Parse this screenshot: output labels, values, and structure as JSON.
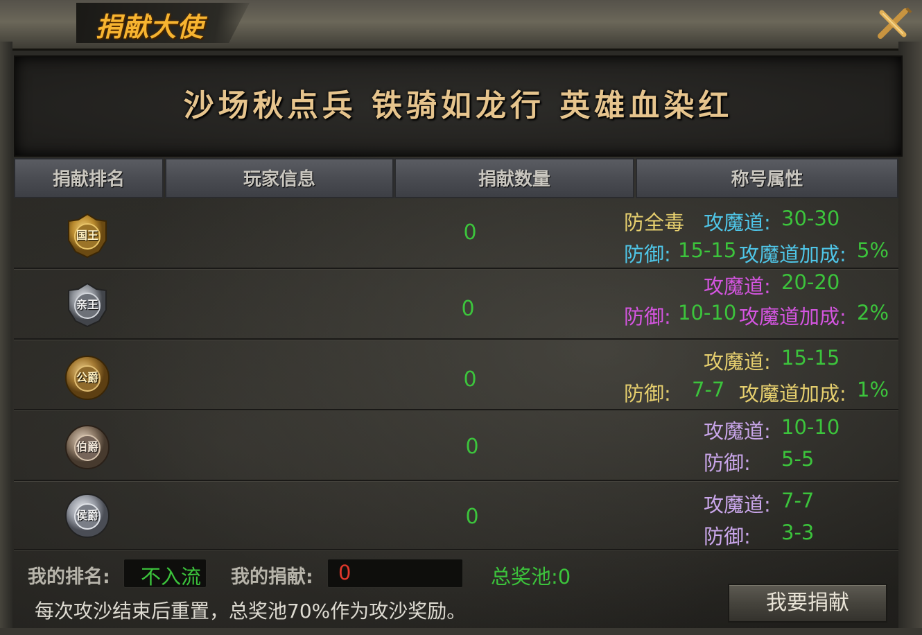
{
  "window": {
    "title": "捐献大使"
  },
  "banner": {
    "slogan": "沙场秋点兵 铁骑如龙行 英雄血染红"
  },
  "table": {
    "headers": [
      "捐献排名",
      "玩家信息",
      "捐献数量",
      "称号属性"
    ],
    "rows": [
      {
        "rank_title": "国王",
        "player": "",
        "amount": "0",
        "attributes": {
          "poison_resist": "防全毒",
          "magic_label": "攻魔道:",
          "magic_value": "30-30",
          "defense_label": "防御:",
          "defense_value": "15-15",
          "bonus_label": "攻魔道加成:",
          "bonus_value": "5%"
        }
      },
      {
        "rank_title": "亲王",
        "player": "",
        "amount": "0",
        "attributes": {
          "magic_label": "攻魔道:",
          "magic_value": "20-20",
          "defense_label": "防御:",
          "defense_value": "10-10",
          "bonus_label": "攻魔道加成:",
          "bonus_value": "2%"
        }
      },
      {
        "rank_title": "公爵",
        "player": "",
        "amount": "0",
        "attributes": {
          "magic_label": "攻魔道:",
          "magic_value": "15-15",
          "defense_label": "防御:",
          "defense_value": "7-7",
          "bonus_label": "攻魔道加成:",
          "bonus_value": "1%"
        }
      },
      {
        "rank_title": "伯爵",
        "player": "",
        "amount": "0",
        "attributes": {
          "magic_label": "攻魔道:",
          "magic_value": "10-10",
          "defense_label": "防御:",
          "defense_value": "5-5"
        }
      },
      {
        "rank_title": "侯爵",
        "player": "",
        "amount": "0",
        "attributes": {
          "magic_label": "攻魔道:",
          "magic_value": "7-7",
          "defense_label": "防御:",
          "defense_value": "3-3"
        }
      }
    ]
  },
  "footer": {
    "my_rank_label": "我的排名:",
    "my_rank_value": "不入流",
    "my_donation_label": "我的捐献:",
    "my_donation_value": "0",
    "prize_pool": "总奖池:0",
    "note": "每次攻沙结束后重置，总奖池70%作为攻沙奖励。",
    "donate_button": "我要捐献"
  },
  "colors": {
    "title_gold": "#f7b430",
    "value_green": "#3cc43c",
    "tier1_label": "#e6cf6e",
    "tier1_accent": "#4fc6e8",
    "tier2_label": "#d455e0",
    "tier3_label": "#e6cf6e",
    "tier45_label": "#c9a6ea",
    "donation_red": "#e0382b"
  },
  "icons": {
    "close": "close-x-icon",
    "medals": [
      "king-medal-icon",
      "prince-medal-icon",
      "duke-medal-icon",
      "earl-medal-icon",
      "marquis-medal-icon"
    ]
  }
}
